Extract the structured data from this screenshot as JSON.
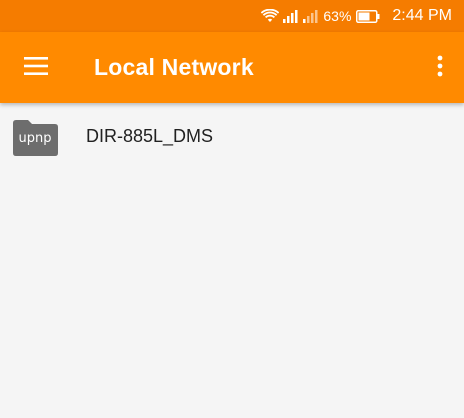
{
  "status_bar": {
    "battery_percent": "63%",
    "time": "2:44 PM",
    "icons": [
      "wifi-icon",
      "signal-icon",
      "signal-weak-icon",
      "battery-icon"
    ]
  },
  "toolbar": {
    "title": "Local Network",
    "menu_icon": "hamburger-menu-icon",
    "overflow_icon": "more-vert-icon"
  },
  "list": {
    "items": [
      {
        "icon_label": "upnp",
        "name": "DIR-885L_DMS"
      }
    ]
  },
  "colors": {
    "status_bar": "#f57c00",
    "toolbar": "#ff8a00",
    "folder": "#6d6d6d",
    "background": "#f5f5f5"
  }
}
